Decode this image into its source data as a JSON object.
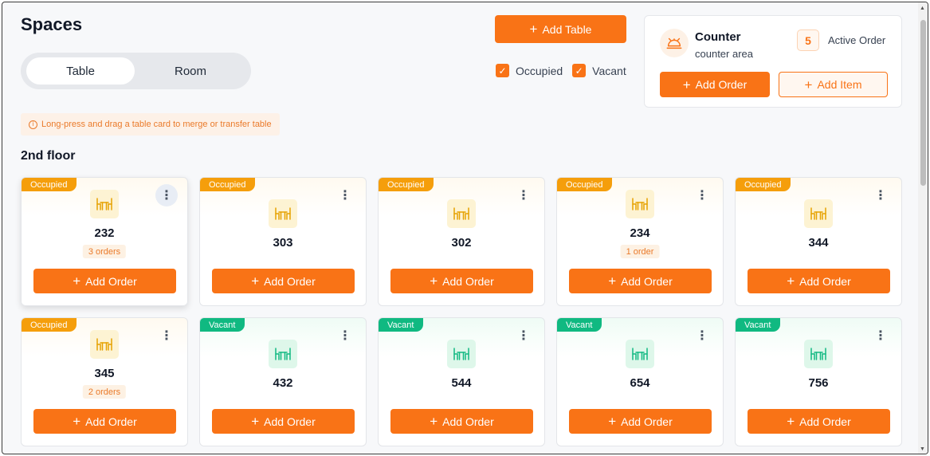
{
  "page": {
    "title": "Spaces"
  },
  "view_toggle": {
    "options": [
      "Table",
      "Room"
    ],
    "selected": "Table"
  },
  "actions": {
    "add_table_label": "Add Table"
  },
  "filters": [
    {
      "label": "Occupied",
      "checked": true
    },
    {
      "label": "Vacant",
      "checked": true
    }
  ],
  "counter": {
    "name": "Counter",
    "subtitle": "counter area",
    "active_count": "5",
    "active_label": "Active Order",
    "add_order_label": "Add Order",
    "add_item_label": "Add Item"
  },
  "hint": {
    "text": "Long-press and drag a table card to merge or transfer table"
  },
  "floor": {
    "name": "2nd floor"
  },
  "tables": [
    {
      "number": "232",
      "status": "Occupied",
      "orders": "3 orders",
      "button": "Add Order"
    },
    {
      "number": "303",
      "status": "Occupied",
      "orders": "",
      "button": "Add Order"
    },
    {
      "number": "302",
      "status": "Occupied",
      "orders": "",
      "button": "Add Order"
    },
    {
      "number": "234",
      "status": "Occupied",
      "orders": "1 order",
      "button": "Add Order"
    },
    {
      "number": "344",
      "status": "Occupied",
      "orders": "",
      "button": "Add Order"
    },
    {
      "number": "345",
      "status": "Occupied",
      "orders": "2 orders",
      "button": "Add Order"
    },
    {
      "number": "432",
      "status": "Vacant",
      "orders": "",
      "button": "Add Order"
    },
    {
      "number": "544",
      "status": "Vacant",
      "orders": "",
      "button": "Add Order"
    },
    {
      "number": "654",
      "status": "Vacant",
      "orders": "",
      "button": "Add Order"
    },
    {
      "number": "756",
      "status": "Vacant",
      "orders": "",
      "button": "Add Order"
    }
  ],
  "icons": {
    "counter": "cloche-icon",
    "table": "dining-table-icon",
    "menu": "more-vertical-icon",
    "plus": "plus-icon",
    "info": "info-icon",
    "check": "check-icon"
  },
  "colors": {
    "accent": "#f97316",
    "occupied": "#f59e0b",
    "vacant": "#10b981"
  }
}
